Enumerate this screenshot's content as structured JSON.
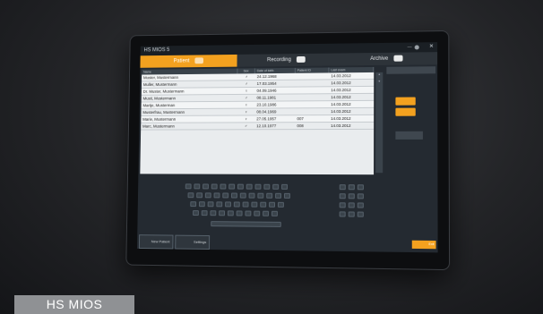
{
  "caption": "HS MIOS",
  "app": {
    "title": "HS MIOS 5",
    "status": "—"
  },
  "tabs": [
    {
      "label": "Patient",
      "icon": "patients-icon",
      "active": true
    },
    {
      "label": "Recording",
      "icon": "camera-icon",
      "active": false
    },
    {
      "label": "Archive",
      "icon": "archive-icon",
      "active": false
    }
  ],
  "table": {
    "headers": [
      "Name",
      "Sex",
      "Date of birth",
      "Patient ID",
      "Last exam"
    ],
    "rows": [
      [
        "Muster, Mustermann",
        "♂",
        "24.12.1968",
        "",
        "14.03.2012"
      ],
      [
        "Muller, Mustermann",
        "♂",
        "17.03.1954",
        "",
        "14.03.2012"
      ],
      [
        "Dr. Muster, Mustermann",
        "♀",
        "04.09.1946",
        "",
        "14.03.2012"
      ],
      [
        "Musti, Mustermann",
        "♂",
        "08.11.1981",
        "",
        "14.03.2012"
      ],
      [
        "Martje, Musterman",
        "♀",
        "23.10.1986",
        "",
        "14.03.2012"
      ],
      [
        "Musterfrau, Mustermann",
        "♀",
        "08.04.1969",
        "",
        "14.03.2012"
      ],
      [
        "Marie, Mustermann",
        "♀",
        "27.05.1957",
        "007",
        "14.03.2012"
      ],
      [
        "Marc, Mustermann",
        "♂",
        "12.10.1977",
        "008",
        "14.03.2012"
      ]
    ]
  },
  "keyboard": {
    "altgr_label": "ALT Gr"
  },
  "bottom_buttons": [
    {
      "label": "New Patient",
      "icon": "user-add-icon"
    },
    {
      "label": "Settings",
      "icon": "settings-icon"
    }
  ],
  "corner_button": "Exit",
  "colors": {
    "accent": "#f3a11f",
    "screen_bg": "#242a31"
  }
}
